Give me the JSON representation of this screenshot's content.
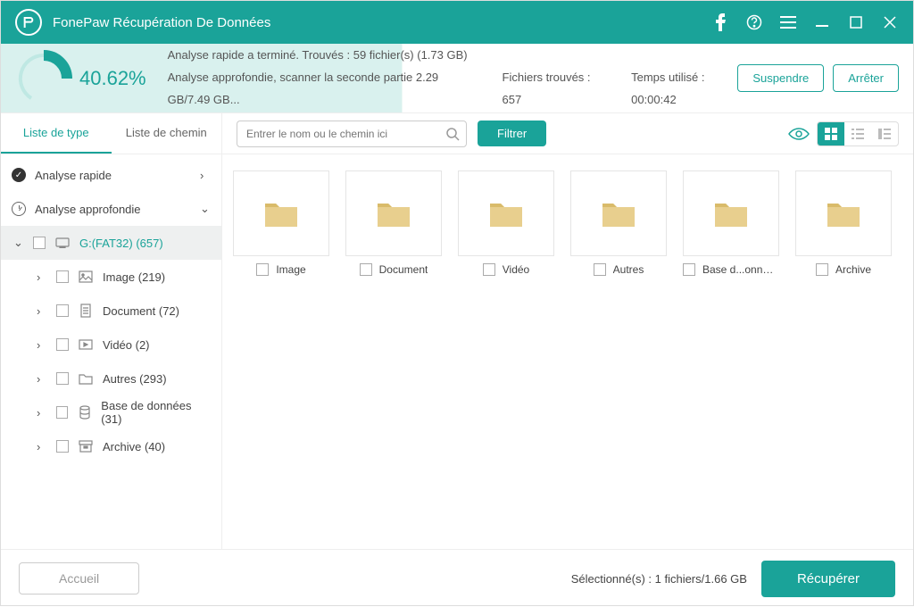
{
  "app_title": "FonePaw Récupération De Données",
  "status": {
    "percent": "40.62%",
    "line1": "Analyse rapide a terminé. Trouvés : 59 fichier(s) (1.73 GB)",
    "deep_prefix": "Analyse approfondie, scanner la seconde partie 2.29 GB/7.49 GB...",
    "found": "Fichiers trouvés : 657",
    "time": "Temps utilisé : 00:00:42",
    "suspend": "Suspendre",
    "stop": "Arrêter"
  },
  "tabs": {
    "type": "Liste de type",
    "path": "Liste de chemin"
  },
  "tree": {
    "quick": "Analyse rapide",
    "deep": "Analyse approfondie",
    "drive": "G:(FAT32) (657)",
    "children": [
      {
        "label": "Image (219)"
      },
      {
        "label": "Document (72)"
      },
      {
        "label": "Vidéo (2)"
      },
      {
        "label": "Autres (293)"
      },
      {
        "label": "Base de données (31)"
      },
      {
        "label": "Archive (40)"
      }
    ]
  },
  "toolbar": {
    "search_placeholder": "Entrer le nom ou le chemin ici",
    "filter": "Filtrer"
  },
  "folders": [
    {
      "label": "Image"
    },
    {
      "label": "Document"
    },
    {
      "label": "Vidéo"
    },
    {
      "label": "Autres"
    },
    {
      "label": "Base d...onnées"
    },
    {
      "label": "Archive"
    }
  ],
  "footer": {
    "home": "Accueil",
    "selection": "Sélectionné(s) : 1 fichiers/1.66 GB",
    "recover": "Récupérer"
  }
}
